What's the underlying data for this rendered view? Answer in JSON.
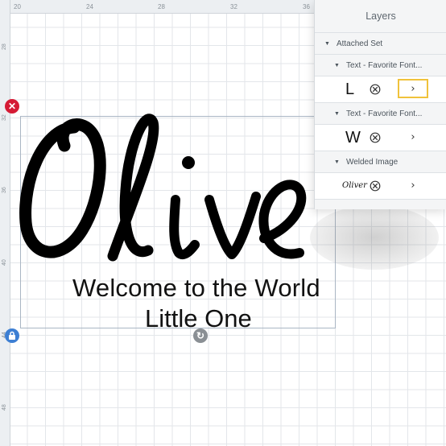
{
  "rulers": {
    "top": [
      "20",
      "24",
      "28",
      "32",
      "36"
    ],
    "left": [
      "28",
      "32",
      "36",
      "40",
      "44",
      "48"
    ]
  },
  "canvas": {
    "main_text": "Olive",
    "line1": "Welcome to the World",
    "line2": "Little One"
  },
  "handles": {
    "delete": "✕",
    "rotate": "↻",
    "lock": "🔒"
  },
  "layers": {
    "title": "Layers",
    "attached_set": "Attached Set",
    "groups": [
      {
        "label": "Text - Favorite Font...",
        "thumb": "L",
        "chevron": "›"
      },
      {
        "label": "Text - Favorite Font...",
        "thumb": "W",
        "chevron": "›"
      },
      {
        "label": "Welded Image",
        "thumb": "Oliver",
        "chevron": "›"
      }
    ]
  },
  "colors": {
    "delete_handle": "#d51b35",
    "lock_handle": "#3d7fd3",
    "focus_outline": "#f0c23b"
  },
  "icons": {
    "delete": "close-icon",
    "lock": "lock-icon",
    "rotate": "rotate-icon",
    "hide": "hide-icon",
    "chevron": "chevron-right-icon",
    "expand": "triangle-down-icon"
  }
}
